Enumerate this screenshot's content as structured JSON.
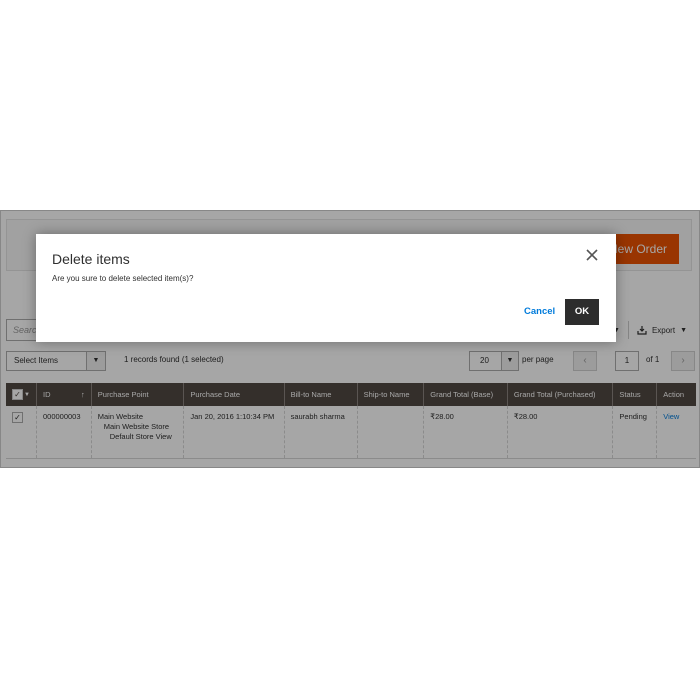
{
  "header": {
    "create_order_label": "Create New Order"
  },
  "search": {
    "placeholder": "Search by keyword"
  },
  "toolbar": {
    "export_label": "Export"
  },
  "actions": {
    "select_items_label": "Select Items",
    "records_text": "1 records found (1 selected)",
    "per_page_value": "20",
    "per_page_label": "per page",
    "page_value": "1",
    "page_of": "of 1"
  },
  "grid": {
    "columns": [
      "ID",
      "Purchase Point",
      "Purchase Date",
      "Bill-to Name",
      "Ship-to Name",
      "Grand Total (Base)",
      "Grand Total (Purchased)",
      "Status",
      "Action"
    ],
    "rows": [
      {
        "id": "000000003",
        "purchase_point": [
          "Main Website",
          "Main Website Store",
          "Default Store View"
        ],
        "purchase_date": "Jan 20, 2016 1:10:34 PM",
        "bill_to": "saurabh sharma",
        "ship_to": "",
        "grand_total_base": "₹28.00",
        "grand_total_purchased": "₹28.00",
        "status": "Pending",
        "action": "View"
      }
    ]
  },
  "modal": {
    "title": "Delete items",
    "message": "Are you sure to delete selected item(s)?",
    "cancel_label": "Cancel",
    "ok_label": "OK"
  },
  "icons": {
    "close": "close-icon",
    "export": "export-icon",
    "check": "checkmark-icon"
  },
  "colors": {
    "accent": "#eb5202",
    "grid_header": "#514943",
    "link": "#007bdb",
    "ok_button": "#2d2d2d"
  }
}
